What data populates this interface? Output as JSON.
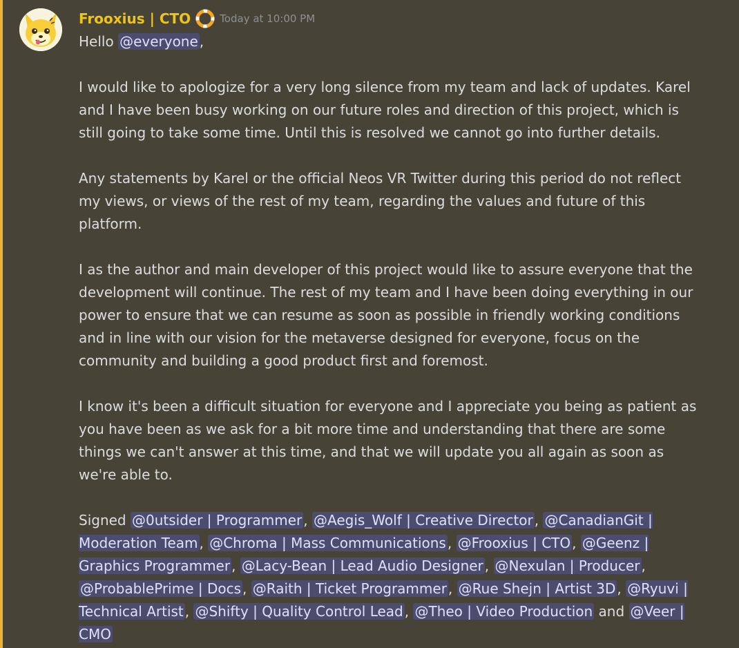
{
  "message": {
    "author": "Frooxius | CTO",
    "timestamp": "Today at 10:00 PM",
    "role_icon": "lifebuoy-icon",
    "accent_color": "#f0b232",
    "greeting_prefix": "Hello",
    "greeting_mention": "@everyone",
    "greeting_suffix": ",",
    "paragraphs": [
      [
        "I would like to apologize for a very long silence from my team and lack of updates. Karel",
        "and I have been busy working on our future roles and direction of this project, which is",
        "still going to take some time. Until this is resolved we cannot go into further details."
      ],
      [
        "Any statements by Karel or the official Neos VR Twitter during this period do not reflect",
        "my views, or views of the rest of my team, regarding the values and future of this",
        "platform."
      ],
      [
        "I as the author and main developer of this project would like to assure everyone that the",
        "development will continue. The rest of my team and I have been doing everything in our",
        "power to ensure that we can resume as soon as possible in friendly working conditions",
        "and in line with our vision for the metaverse designed for everyone, focus on the",
        "community and building a good product first and foremost."
      ],
      [
        "I know it's been a difficult situation for everyone and I appreciate you being as patient as",
        "you have been as we ask for a bit more time and understanding that there are some",
        "things we can't answer at this time, and that we will update you all again as soon as",
        "we're able to."
      ]
    ],
    "signed": {
      "prefix": "Signed",
      "separator": ",",
      "conjunction": "and",
      "mentions": [
        "@0utsider | Programmer",
        "@Aegis_Wolf | Creative Director",
        "@CanadianGit | Moderation Team",
        "@Chroma | Mass Communications",
        "@Frooxius | CTO",
        "@Geenz | Graphics Programmer",
        "@Lacy-Bean | Lead Audio Designer",
        "@Nexulan | Producer",
        "@ProbablePrime | Docs",
        "@Raith | Ticket Programmer",
        "@Rue Shejn | Artist 3D",
        "@Ryuvi | Technical Artist",
        "@Shifty | Quality Control Lead",
        "@Theo | Video Production",
        "@Veer | CMO"
      ]
    }
  }
}
